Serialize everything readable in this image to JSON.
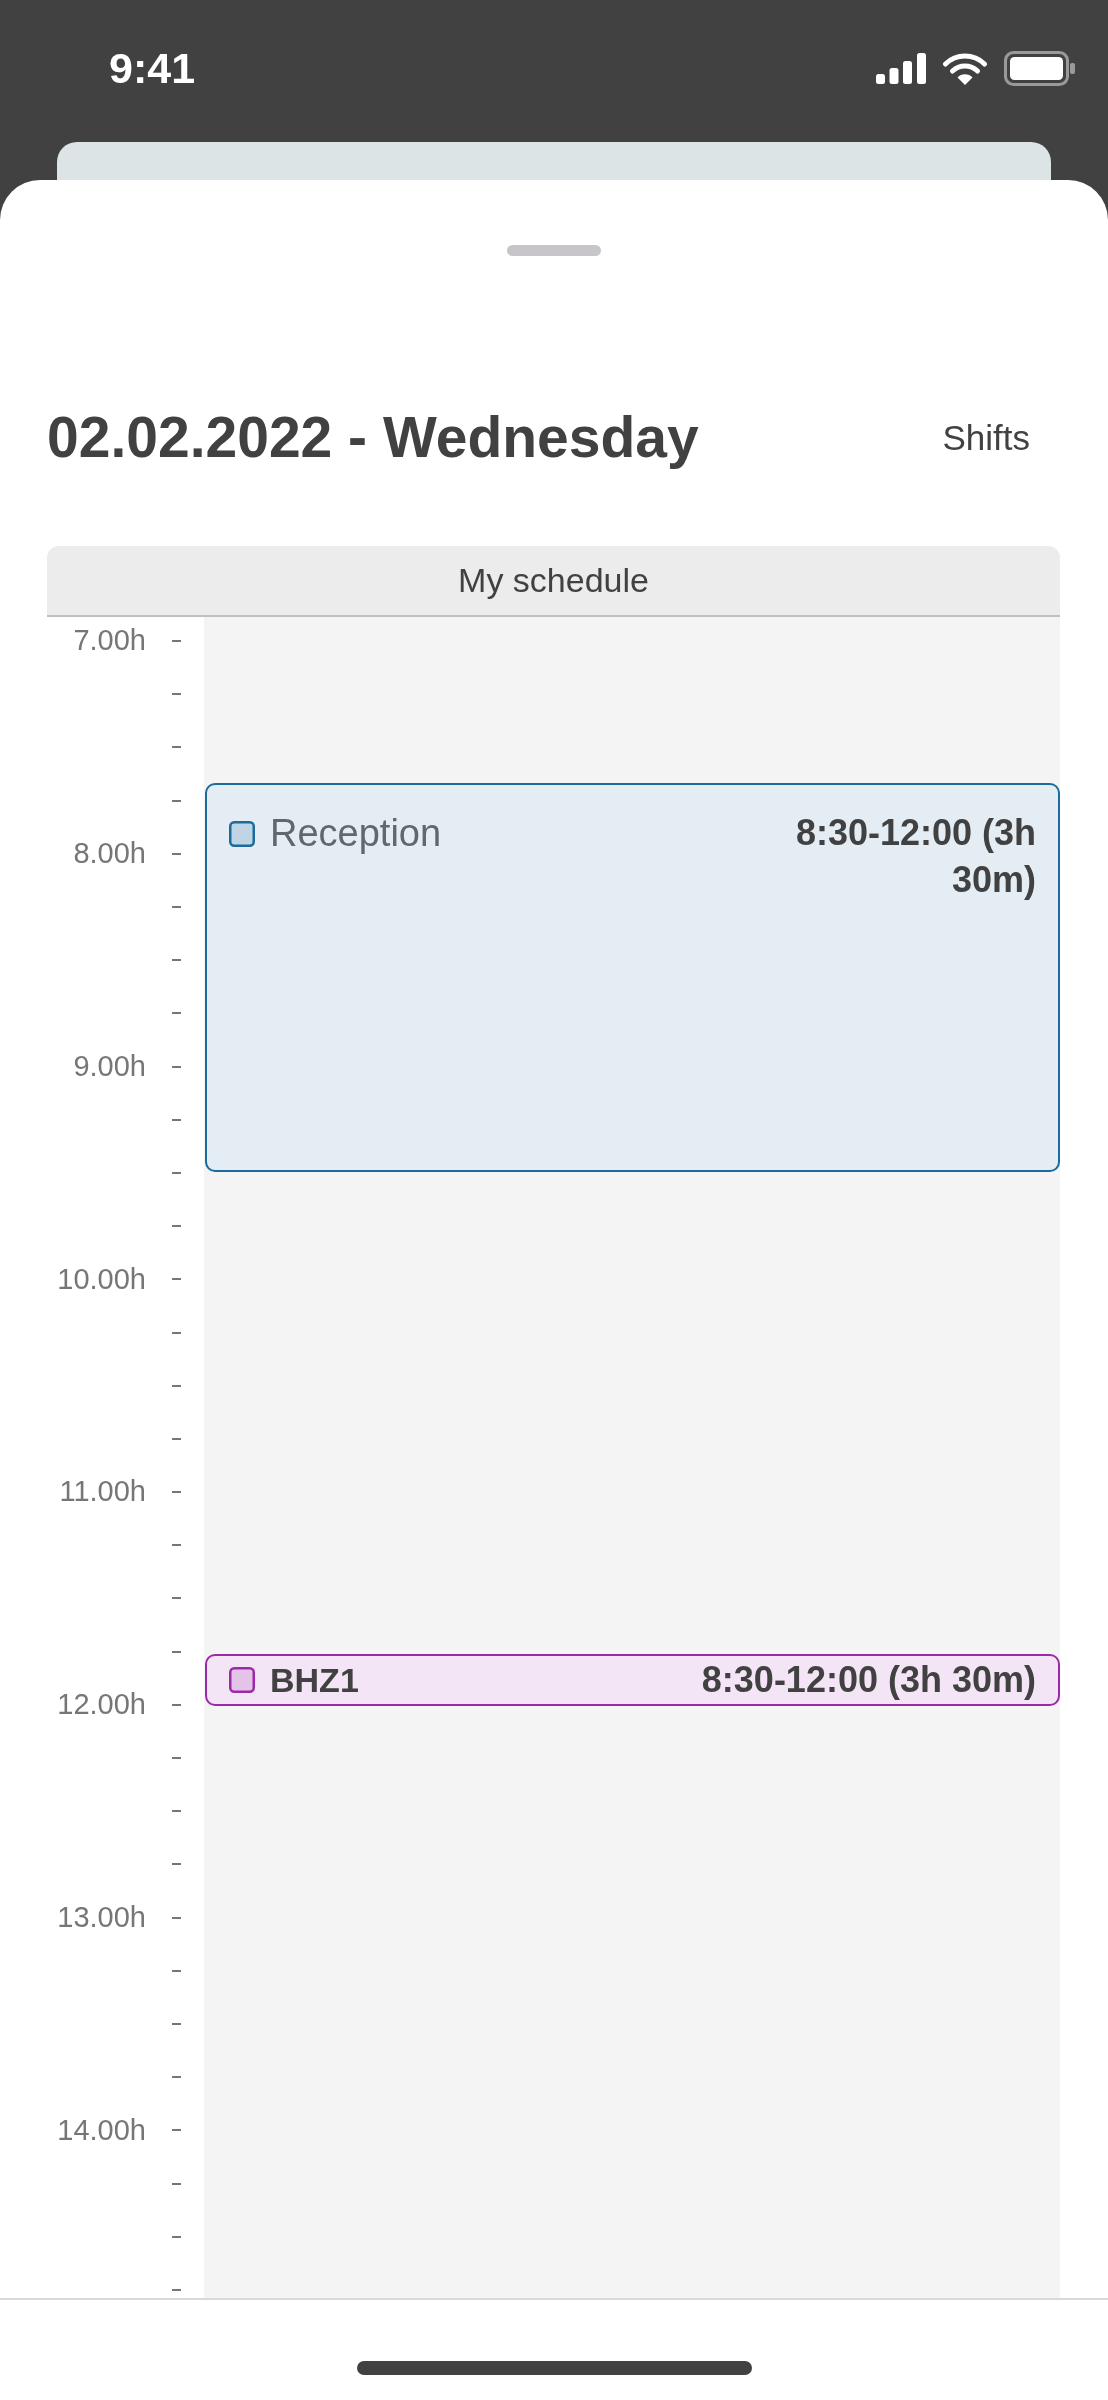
{
  "status_bar": {
    "time": "9:41"
  },
  "header": {
    "title": "02.02.2022 - Wednesday",
    "action": "Shifts"
  },
  "schedule": {
    "title": "My schedule",
    "hours": [
      "7.00h",
      "8.00h",
      "9.00h",
      "10.00h",
      "11.00h",
      "12.00h",
      "13.00h",
      "14.00h"
    ],
    "events": [
      {
        "kind": "block",
        "name": "Reception",
        "time": "8:30-12:00 (3h 30m)",
        "color": "#1d6a9c"
      },
      {
        "kind": "strip",
        "name": "BHZ1",
        "time": "8:30-12:00 (3h 30m)",
        "color": "#9b2aa8"
      }
    ]
  }
}
